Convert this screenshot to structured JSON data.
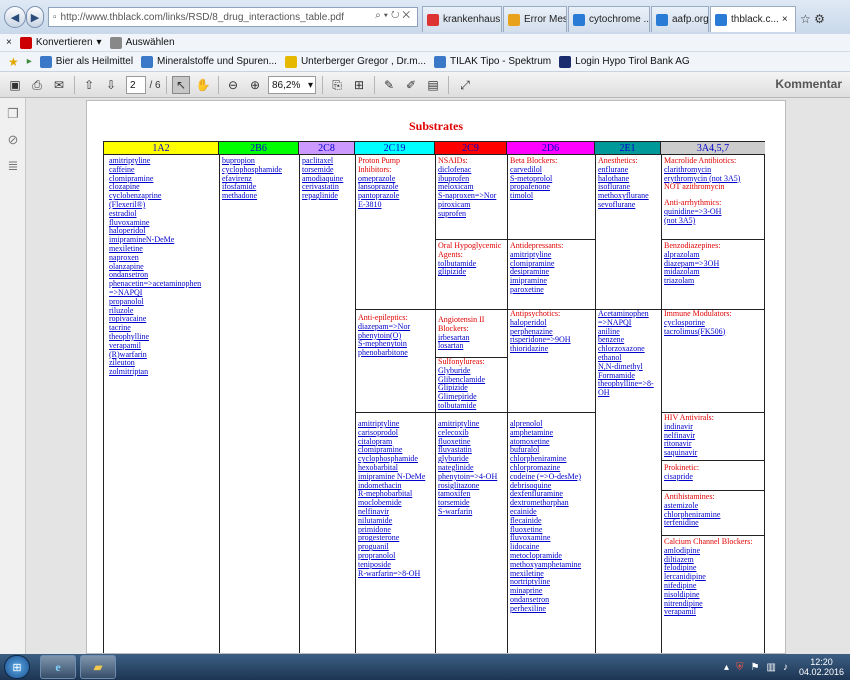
{
  "browser": {
    "url": "http://www.thblack.com/links/RSD/8_drug_interactions_table.pdf",
    "tabs": [
      {
        "label": "krankenhaus ...",
        "color": "#d33"
      },
      {
        "label": "Error Message",
        "color": "#e8a21b"
      },
      {
        "label": "cytochrome ...",
        "color": "#2a7bd6"
      },
      {
        "label": "aafp.org",
        "color": "#2a7bd6"
      },
      {
        "label": "thblack.c...",
        "color": "#2a7bd6"
      }
    ],
    "close_symbol": "×",
    "window_controls": "☆ ⚙",
    "menubar": {
      "convert": "Konvertieren",
      "select": "Auswählen"
    },
    "favorites": [
      {
        "label": "Bier als Heilmittel",
        "color": "#3c78c8"
      },
      {
        "label": "Mineralstoffe und Spuren...",
        "color": "#3c78c8"
      },
      {
        "label": "Unterberger Gregor , Dr.m...",
        "color": "#e6b800"
      },
      {
        "label": "TILAK Tipo - Spektrum",
        "color": "#3c78c8"
      },
      {
        "label": "Login  Hypo Tirol Bank AG",
        "color": "#1a2b6e"
      }
    ]
  },
  "pdf_toolbar": {
    "page_current": "2",
    "page_total": "/ 6",
    "zoom": "86,2%",
    "comment_label": "Kommentar"
  },
  "document": {
    "title": "Substrates",
    "columns": [
      {
        "label": "1A2",
        "color": "#ffff00"
      },
      {
        "label": "2B6",
        "color": "#00ff00"
      },
      {
        "label": "2C8",
        "color": "#cc99ff"
      },
      {
        "label": "2C19",
        "color": "#00ffff"
      },
      {
        "label": "2C9",
        "color": "#ff0000"
      },
      {
        "label": "2D6",
        "color": "#ff00ff"
      },
      {
        "label": "2E1",
        "color": "#009999"
      },
      {
        "label": "3A4,5,7",
        "color": "#cccccc"
      }
    ],
    "cells": {
      "c1a2": {
        "items": [
          "amitriptyline",
          "caffeine",
          "clomipramine",
          "clozapine",
          "cyclobenzaprine",
          "(Flexeril®)",
          "estradiol",
          "fluvoxamine",
          "haloperidol",
          "imipramineN-DeMe",
          "mexiletine",
          "naproxen",
          "olanzapine",
          "ondansetron",
          "phenacetin=>acetaminophen",
          "=>NAPQI",
          "propanolol",
          "riluzole",
          "ropivacaine",
          "tacrine",
          "theophylline",
          "verapamil",
          "(R)warfarin",
          "zileuton",
          "zolmitriptan"
        ]
      },
      "c2b6": {
        "items": [
          "bupropion",
          "cyclophosphamide",
          "efavirenz",
          "ifosfamide",
          "methadone"
        ]
      },
      "c2c8": {
        "items": [
          "paclitaxel",
          "torsemide",
          "amodiaquine",
          "cerivastatin",
          "repaglinide"
        ]
      },
      "c2c19a": {
        "heading": "Proton Pump\nInhibitors:",
        "items": [
          "omeprazole",
          "lansoprazole",
          "pantoprazole",
          "E-3810"
        ]
      },
      "c2c19b": {
        "heading": "Anti-epileptics:",
        "items": [
          "diazepam=>Nor",
          "phenytoin(O)",
          "S-mephenytoin",
          "phenobarbitone"
        ]
      },
      "c2c19c": {
        "items": [
          "amitriptyline",
          "carisoprodol",
          "citalopram",
          "clomipramine",
          "cyclophosphamide",
          "hexobarbital",
          "imipramine N-DeMe",
          "indomethacin",
          "R-mephobarbital",
          "moclobemide",
          "nelfinavir",
          "nilutamide",
          "primidone",
          "progesterone",
          "proguanil",
          "propranolol",
          "teniposide",
          "R-warfarin=>8-OH"
        ]
      },
      "c2c9a": {
        "heading": "NSAIDs:",
        "items": [
          "diclofenac",
          "ibuprofen",
          "meloxicam",
          "S-naproxen=>Nor",
          "piroxicam",
          "suprofen"
        ]
      },
      "c2c9b": {
        "heading": "Oral Hypoglycemic\nAgents:",
        "items": [
          "tolbutamide",
          "glipizide"
        ]
      },
      "c2c9c": {
        "heading": "Angiotensin II\nBlockers:",
        "items": [
          "irbesartan",
          "losartan"
        ]
      },
      "c2c9d": {
        "heading": "Sulfonylureas:",
        "items": [
          "Glyburide",
          "Glibenclamide",
          "Glipizide",
          "Glimepiride",
          "tolbutamide"
        ]
      },
      "c2c9e": {
        "items": [
          "amitriptyline",
          "celecoxib",
          "fluoxetine",
          "fluvastatin",
          "glyburide",
          "nateglinide",
          "phenytoin=>4-OH",
          "rosiglitazone",
          "tamoxifen",
          "torsemide",
          "S-warfarin"
        ]
      },
      "c2d6a": {
        "heading": "Beta Blockers:",
        "items": [
          "carvedilol",
          "S-metoprolol",
          "propafenone",
          "timolol"
        ]
      },
      "c2d6b": {
        "heading": "Antidepressants:",
        "items": [
          "amitriptyline",
          "clomipramine",
          "desipramine",
          "imipramine",
          "paroxetine"
        ]
      },
      "c2d6c": {
        "heading": "Antipsychotics:",
        "items": [
          "haloperidol",
          "perphenazine",
          "risperidone=>9OH",
          "thioridazine"
        ]
      },
      "c2d6d": {
        "items": [
          "alprenolol",
          "amphetamine",
          "atomoxetine",
          "bufuralol",
          "chlorpheniramine",
          "chlorpromazine",
          "codeine (=>O-desMe)",
          "debrisoquine",
          "dexfenfluramine",
          "dextromethorphan",
          "ecainide",
          "flecainide",
          "fluoxetine",
          "fluvoxamine",
          "lidocaine",
          "metoclopramide",
          "methoxyamphetamine",
          "mexiletine",
          "nortriptyline",
          "minaprine",
          "ondansetron",
          "perhexiline"
        ]
      },
      "c2e1a": {
        "heading": "Anesthetics:",
        "items": [
          "enflurane",
          "halothane",
          "isoflurane",
          "methoxyflurane",
          "sevoflurane"
        ]
      },
      "c2e1b": {
        "items": [
          "Acetaminophen",
          "=>NAPQI",
          "aniline",
          "benzene",
          "chlorzoxazone",
          "ethanol",
          "N,N-dimethyl",
          "Formamide",
          "theophylline=>8-",
          "OH"
        ]
      },
      "c3a4a": {
        "heading": "Macrolide Antibiotics:",
        "items": [
          "clarithromycin",
          "erythromycin (not 3A5)"
        ],
        "plain": [
          "NOT azithromycin"
        ],
        "heading2": "Anti-arrhythmics:",
        "items2": [
          "quinidine=>3-OH",
          "(not 3A5)"
        ]
      },
      "c3a4b": {
        "heading": "Benzodiazepines:",
        "items": [
          "alprazolam",
          "diazepam=>3OH",
          "midazolam",
          "triazolam"
        ]
      },
      "c3a4c": {
        "heading": "Immune Modulators:",
        "items": [
          "cyclosporine",
          "tacrolimus(FK506)"
        ]
      },
      "c3a4d": {
        "heading": "HIV Antivirals:",
        "items": [
          "indinavir",
          "nelfinavir",
          "ritonavir",
          "saquinavir"
        ]
      },
      "c3a4e": {
        "heading": "Prokinetic:",
        "items": [
          "cisapride"
        ]
      },
      "c3a4f": {
        "heading": "Antihistamines:",
        "items": [
          "astemizole",
          "chlorpheniramine",
          "terfenidine"
        ]
      },
      "c3a4g": {
        "heading": "Calcium Channel Blockers:",
        "items": [
          "amlodipine",
          "diltiazem",
          "felodipine",
          "lercanidipine",
          "nifedipine",
          "nisoldipine",
          "nitrendipine",
          "verapamil"
        ]
      }
    }
  },
  "taskbar": {
    "time": "12:20",
    "date": "04.02.2016"
  }
}
